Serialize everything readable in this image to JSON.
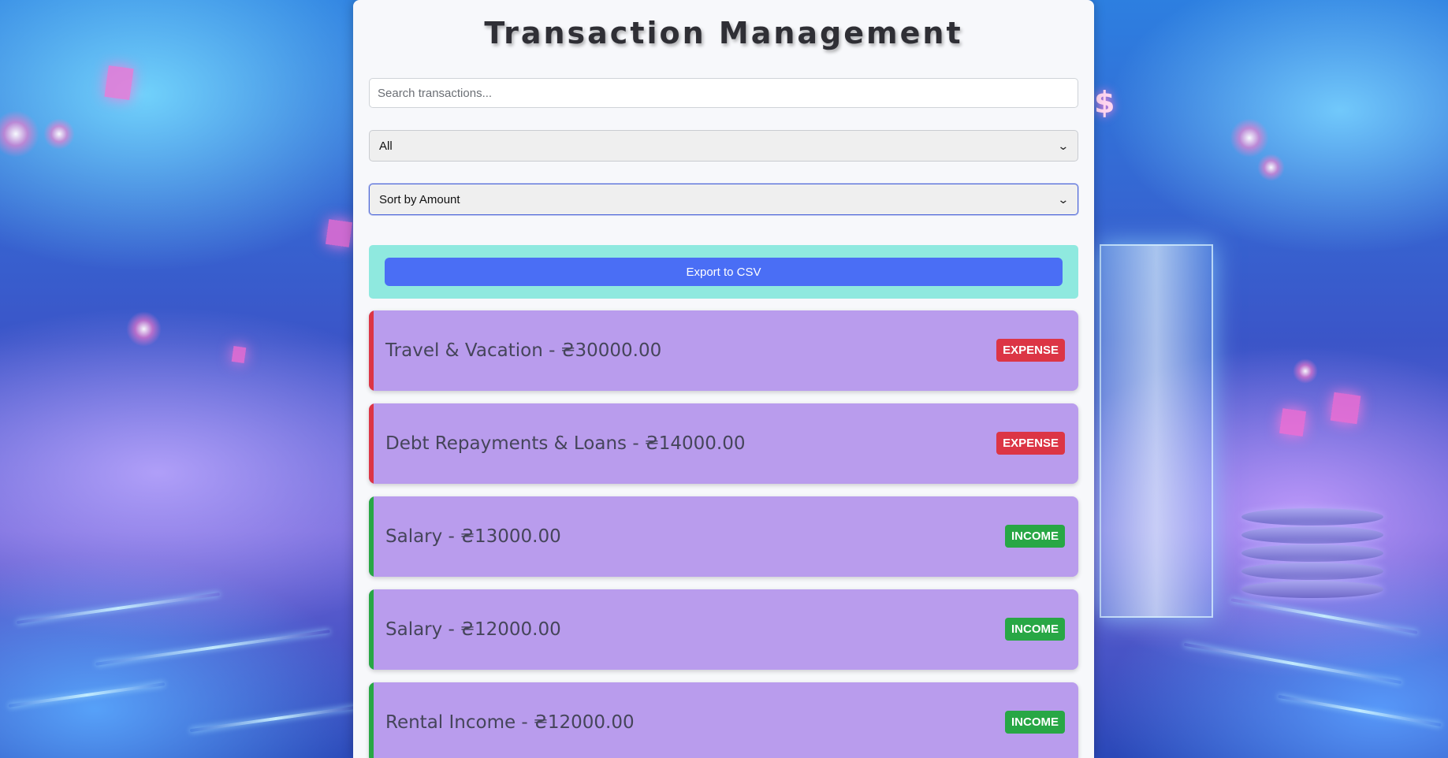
{
  "header": {
    "title": "Transaction Management"
  },
  "search": {
    "placeholder": "Search transactions..."
  },
  "filters": {
    "type_selected": "All",
    "sort_selected": "Sort by Amount"
  },
  "toolbar": {
    "export_label": "Export to CSV"
  },
  "colors": {
    "expense": "#dc3545",
    "income": "#28a745",
    "card_bg": "#b99ced",
    "export_button": "#4a6ef5",
    "export_panel": "#8fe9df"
  },
  "transactions": [
    {
      "text": "Travel & Vacation - ₴30000.00",
      "type": "EXPENSE"
    },
    {
      "text": "Debt Repayments & Loans - ₴14000.00",
      "type": "EXPENSE"
    },
    {
      "text": "Salary - ₴13000.00",
      "type": "INCOME"
    },
    {
      "text": "Salary - ₴12000.00",
      "type": "INCOME"
    },
    {
      "text": "Rental Income - ₴12000.00",
      "type": "INCOME"
    }
  ]
}
